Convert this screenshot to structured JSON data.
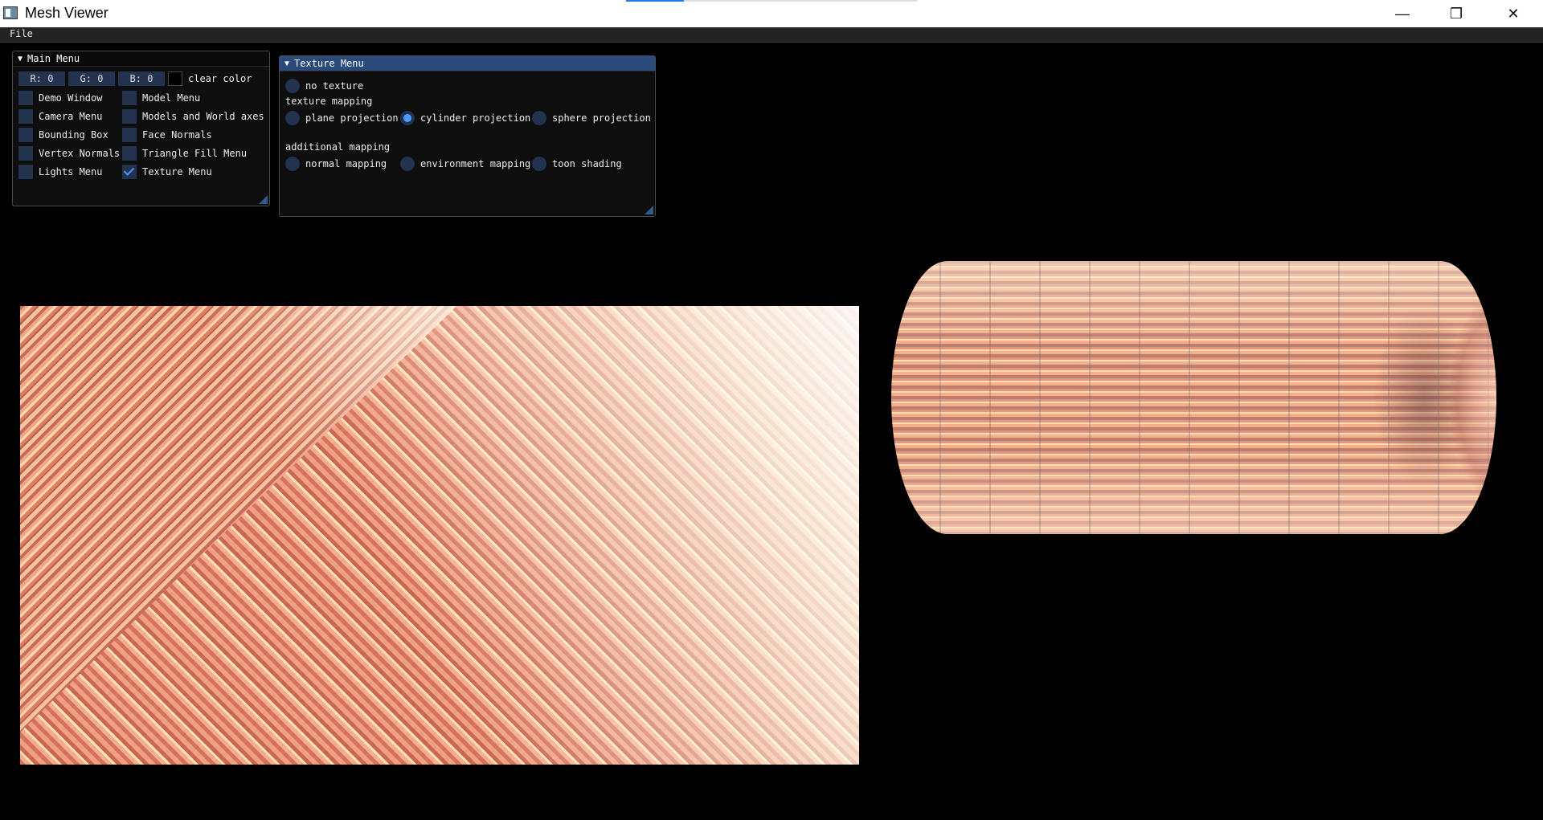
{
  "window": {
    "title": "Mesh Viewer",
    "controls": {
      "minimize": "—",
      "maximize": "❐",
      "close": "✕"
    }
  },
  "menubar": {
    "items": [
      "File"
    ]
  },
  "main_menu": {
    "title": "Main Menu",
    "clear_color": {
      "r": "R: 0",
      "g": "G: 0",
      "b": "B: 0",
      "label": "clear color",
      "swatch": "#000000"
    },
    "checkboxes": [
      {
        "label": "Demo Window",
        "checked": false
      },
      {
        "label": "Model Menu",
        "checked": false
      },
      {
        "label": "Camera Menu",
        "checked": false
      },
      {
        "label": "Models and World axes",
        "checked": false
      },
      {
        "label": "Bounding Box",
        "checked": false
      },
      {
        "label": "Face Normals",
        "checked": false
      },
      {
        "label": "Vertex Normals",
        "checked": false
      },
      {
        "label": "Triangle Fill Menu",
        "checked": false
      },
      {
        "label": "Lights Menu",
        "checked": false
      },
      {
        "label": "Texture Menu",
        "checked": true
      }
    ]
  },
  "texture_menu": {
    "title": "Texture Menu",
    "no_texture": {
      "label": "no texture",
      "selected": false
    },
    "mapping_heading": "texture mapping",
    "mapping_options": [
      {
        "label": "plane projection",
        "selected": false
      },
      {
        "label": "cylinder projection",
        "selected": true
      },
      {
        "label": "sphere projection",
        "selected": false
      }
    ],
    "additional_heading": "additional mapping",
    "additional_options": [
      {
        "label": "normal mapping",
        "selected": false
      },
      {
        "label": "environment mapping",
        "selected": false
      },
      {
        "label": "toon shading",
        "selected": false
      }
    ]
  },
  "colors": {
    "accent": "#4d9aff",
    "frame_bg": "#22324f",
    "title_active": "#294a7a"
  }
}
